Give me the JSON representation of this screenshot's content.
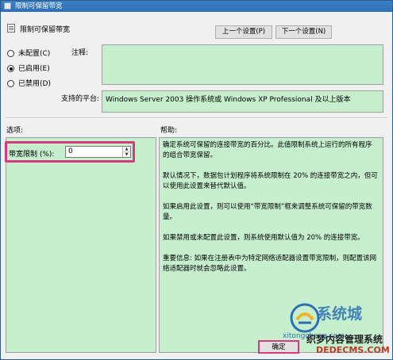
{
  "window": {
    "title": "限制可保留带宽",
    "header_title": "限制可保留带宽"
  },
  "nav": {
    "prev_label": "上一个设置(P)",
    "next_label": "下一个设置(N)"
  },
  "state": {
    "options": [
      {
        "label": "未配置(C)",
        "checked": false
      },
      {
        "label": "已启用(E)",
        "checked": true
      },
      {
        "label": "已禁用(D)",
        "checked": false
      }
    ]
  },
  "comment": {
    "label": "注释:",
    "value": ""
  },
  "platform": {
    "label": "支持的平台:",
    "value": "Windows Server 2003 操作系统或 Windows XP Professional 及以上版本"
  },
  "options_section": {
    "label": "选项:",
    "bandwidth_label": "带宽限制 (%):",
    "bandwidth_value": "0"
  },
  "help": {
    "label": "帮助:",
    "paragraphs": [
      "确定系统可保留的连接带宽的百分比。此值限制系统上运行的所有程序的组合带宽保留。",
      "默认情况下，数据包计划程序将系统限制在 20% 的连接带宽之内，但可以使用此设置来替代默认值。",
      "如果启用此设置，则可以使用“带宽限制”框来调整系统可保留的带宽数量。",
      "如果禁用或未配置此设置，则系统使用默认值为 20% 的连接带宽。",
      "重要信息: 如果在注册表中为特定网络适配器设置带宽限制，则配置该网络适配器时就会忽略此设置。"
    ]
  },
  "footer": {
    "ok_label": "确定"
  },
  "watermark": {
    "brand": "系统城",
    "domain": "xitongcheng.com",
    "cms_title": "织梦内容管理系统",
    "cms_domain": "DEDECMS.COM"
  },
  "colors": {
    "accent": "#d63a7f",
    "titlebar": "#2f6fb5",
    "field_bg": "#c6efce"
  }
}
